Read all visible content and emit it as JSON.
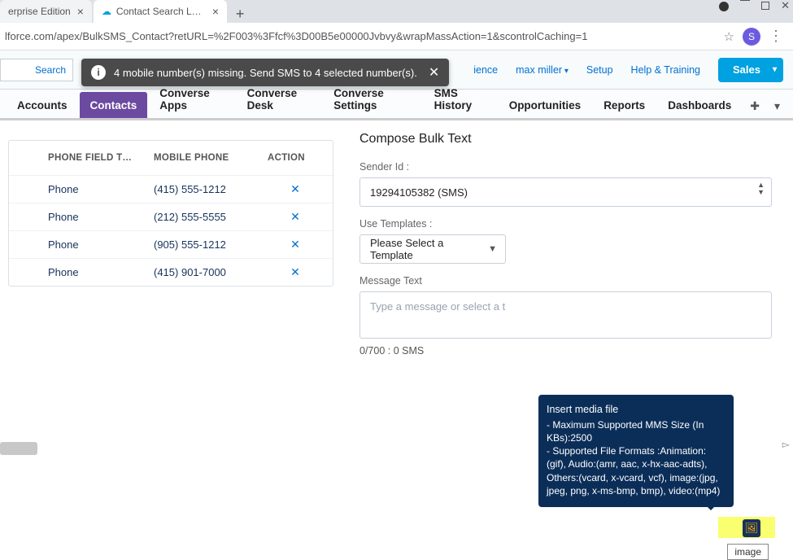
{
  "browser": {
    "tabs": [
      {
        "title": "erprise Edition",
        "active": false
      },
      {
        "title": "Contact Search Layouts ~ Salesfo",
        "active": true
      }
    ],
    "url": "lforce.com/apex/BulkSMS_Contact?retURL=%2F003%3Ffcf%3D00B5e00000Jvbvy&wrapMassAction=1&scontrolCaching=1",
    "avatar_initial": "S"
  },
  "toast": {
    "text": "4 mobile number(s) missing. Send SMS to 4 selected number(s)."
  },
  "header": {
    "search_label": "Search",
    "links": {
      "experience": "ience",
      "user": "max miller",
      "setup": "Setup",
      "help": "Help & Training"
    },
    "app_button": "Sales"
  },
  "nav": {
    "tabs": [
      "Accounts",
      "Contacts",
      "Converse Apps",
      "Converse Desk",
      "Converse Settings",
      "SMS History",
      "Opportunities",
      "Reports",
      "Dashboards"
    ],
    "active_index": 1
  },
  "grid": {
    "cols": {
      "phonefield": "PHONE FIELD T…",
      "mobile": "MOBILE PHONE",
      "action": "ACTION"
    },
    "rows": [
      {
        "type": "Phone",
        "mobile": "(415) 555-1212"
      },
      {
        "type": "Phone",
        "mobile": "(212) 555-5555"
      },
      {
        "type": "Phone",
        "mobile": "(905) 555-1212"
      },
      {
        "type": "Phone",
        "mobile": "(415) 901-7000"
      }
    ],
    "action_glyph": "✕"
  },
  "compose": {
    "title": "Compose Bulk Text",
    "sender_label": "Sender Id :",
    "sender_value": "19294105382 (SMS)",
    "templates_label": "Use Templates :",
    "templates_value": "Please Select a Template",
    "message_label": "Message Text",
    "message_placeholder": "Type a message or select a t",
    "counter": "0/700 : 0 SMS"
  },
  "popover": {
    "title": "Insert media file",
    "line1": "-  Maximum Supported MMS Size (In KBs):2500",
    "line2": "-  Supported File Formats :Animation:(gif), Audio:(amr, aac, x-hx-aac-adts), Others:(vcard, x-vcard, vcf), image:(jpg, jpeg, png, x-ms-bmp, bmp), video:(mp4)"
  },
  "tooltip_label": "image"
}
